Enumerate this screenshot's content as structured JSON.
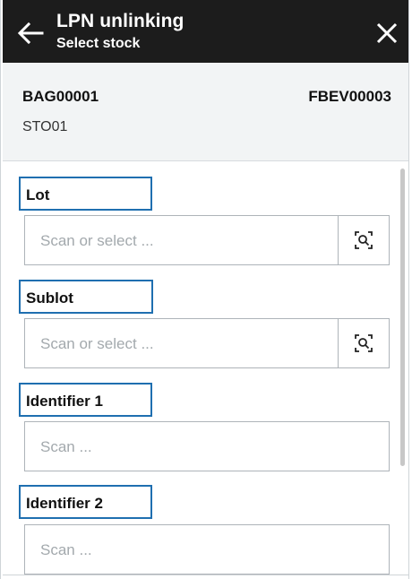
{
  "header": {
    "title": "LPN unlinking",
    "subtitle": "Select stock"
  },
  "summary": {
    "bag": "BAG00001",
    "fbev": "FBEV00003",
    "sto": "STO01"
  },
  "fields": {
    "lot": {
      "label": "Lot",
      "placeholder": "Scan or select ..."
    },
    "sublot": {
      "label": "Sublot",
      "placeholder": "Scan or select ..."
    },
    "identifier1": {
      "label": "Identifier 1",
      "placeholder": "Scan ..."
    },
    "identifier2": {
      "label": "Identifier 2",
      "placeholder": "Scan ..."
    }
  },
  "icons": {
    "back": "arrow-left-icon",
    "close": "close-icon",
    "lookup": "search-select-icon"
  },
  "colors": {
    "header_bg": "#1c1c1c",
    "summary_bg": "#f2f4f5",
    "highlight_border": "#1f6fb0"
  }
}
